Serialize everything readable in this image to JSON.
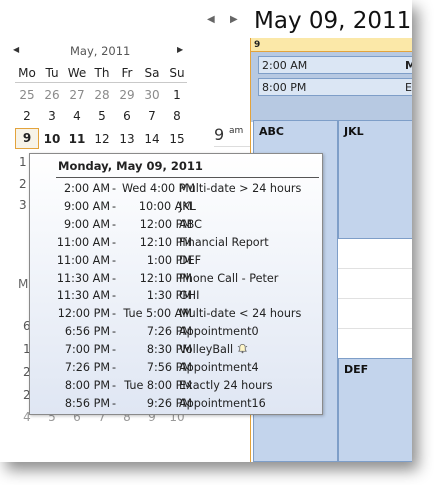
{
  "header": {
    "date": "May 09, 2011"
  },
  "mini_calendar": {
    "month_title": "May, 2011",
    "days_of_week": [
      "Mo",
      "Tu",
      "We",
      "Th",
      "Fr",
      "Sa",
      "Su"
    ],
    "weeks": [
      [
        "25",
        "26",
        "27",
        "28",
        "29",
        "30",
        "1"
      ],
      [
        "2",
        "3",
        "4",
        "5",
        "6",
        "7",
        "8"
      ],
      [
        "9",
        "10",
        "11",
        "12",
        "13",
        "14",
        "15"
      ]
    ],
    "peek_left": [
      "1",
      "2",
      "3"
    ],
    "peek_month_char": "M",
    "peek_next": [
      "6",
      "1",
      "2",
      "2",
      "4",
      "5",
      "6",
      "7",
      "8",
      "9",
      "10"
    ]
  },
  "time_gutter": {
    "hour": "9",
    "ampm": "am"
  },
  "day_view": {
    "column_header": "9",
    "all_day": [
      {
        "time": "2:00 AM",
        "title": "Mu"
      },
      {
        "time": "8:00 PM",
        "title": "E"
      }
    ],
    "appointments": [
      "ABC",
      "JKL",
      "DEF"
    ]
  },
  "tooltip": {
    "title": "Monday, May 09, 2011",
    "rows": [
      {
        "start": "2:00 AM",
        "end": "Wed 4:00 PM",
        "subject": "Multi-date > 24 hours"
      },
      {
        "start": "9:00 AM",
        "end": "10:00 AM",
        "subject": "JKL"
      },
      {
        "start": "9:00 AM",
        "end": "12:00 PM",
        "subject": "ABC"
      },
      {
        "start": "11:00 AM",
        "end": "12:10 PM",
        "subject": "Financial Report"
      },
      {
        "start": "11:00 AM",
        "end": "1:00 PM",
        "subject": "DEF"
      },
      {
        "start": "11:30 AM",
        "end": "12:10 PM",
        "subject": "Phone Call - Peter"
      },
      {
        "start": "11:30 AM",
        "end": "1:30 PM",
        "subject": "GHI"
      },
      {
        "start": "12:00 PM",
        "end": "Tue 5:00 AM",
        "subject": "Multi-date < 24 hours"
      },
      {
        "start": "6:56 PM",
        "end": "7:26 PM",
        "subject": "Appointment0"
      },
      {
        "start": "7:00 PM",
        "end": "8:30 PM",
        "subject": "VolleyBall"
      },
      {
        "start": "7:26 PM",
        "end": "7:56 PM",
        "subject": "Appointment4"
      },
      {
        "start": "8:00 PM",
        "end": "Tue 8:00 PM",
        "subject": "Exactly 24 hours"
      },
      {
        "start": "8:56 PM",
        "end": "9:26 PM",
        "subject": "Appointment16"
      }
    ],
    "reminder_icon_row": 9
  },
  "colors": {
    "today_border": "#e3a33c",
    "allday_bg": "#b7c9e2",
    "appt_bg": "#c3d4ec"
  }
}
